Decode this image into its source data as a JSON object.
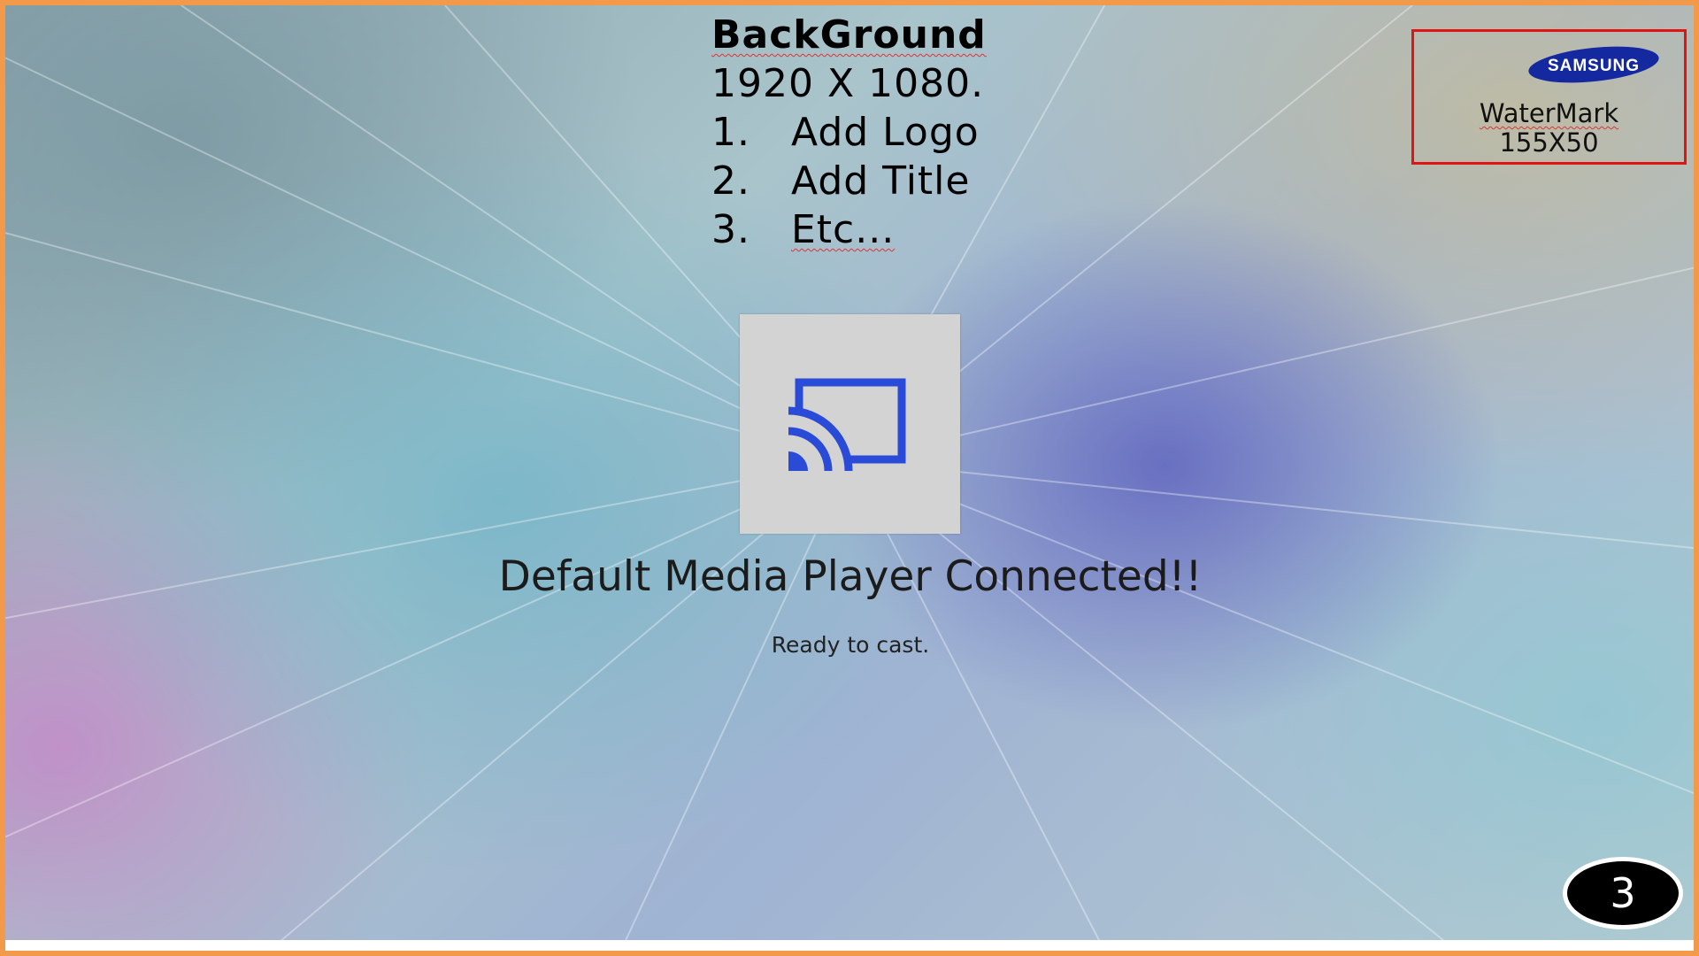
{
  "instructions": {
    "title": "BackGround",
    "size": "1920 X 1080.",
    "items": [
      {
        "num": "1.",
        "text": "Add Logo"
      },
      {
        "num": "2.",
        "text": "Add Title"
      },
      {
        "num": "3.",
        "text": "Etc..."
      }
    ]
  },
  "watermark": {
    "logo_text": "SAMSUNG",
    "label": "WaterMark",
    "size": "155X50",
    "logo_color": "#1428a0",
    "border_color": "#e11414"
  },
  "cast": {
    "icon": "cast-icon",
    "icon_color": "#2a4bd7",
    "title": "Default Media Player Connected!!",
    "subtitle": "Ready to cast."
  },
  "page_number": "3",
  "colors": {
    "frame_border": "#f39a4a"
  }
}
